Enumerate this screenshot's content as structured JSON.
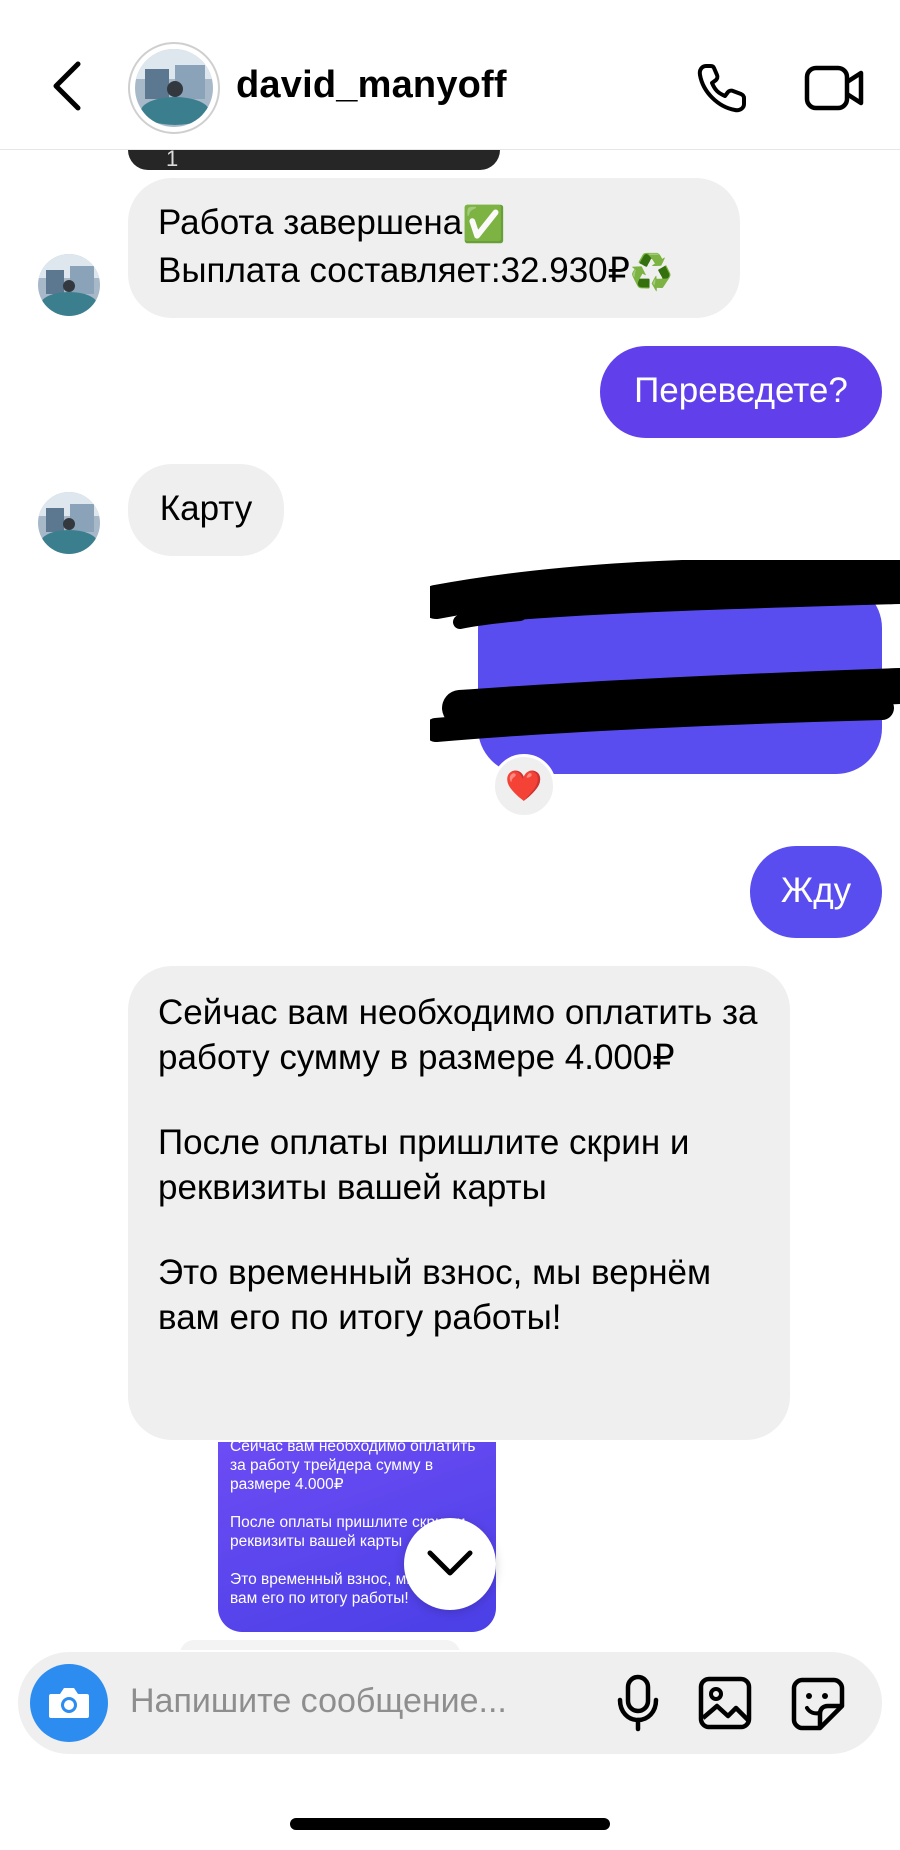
{
  "header": {
    "username": "david_manyoff",
    "icons": [
      "back-chevron-icon",
      "avatar",
      "phone-icon",
      "video-camera-icon"
    ]
  },
  "messages": {
    "stub_count": "1",
    "incoming_1": {
      "line1": "Работа завершена",
      "line1_emoji": "✅",
      "line2": "Выплата составляет:32.930₽",
      "line2_emoji": "♻️"
    },
    "outgoing_1": "Переведете?",
    "incoming_2": "Карту",
    "outgoing_2_redacted": "",
    "reaction": "❤️",
    "outgoing_3": "Жду",
    "incoming_3": {
      "p1": "Сейчас вам необходимо оплатить за работу сумму в размере 4.000₽",
      "p2": "После оплаты пришлите скрин и реквизиты вашей карты",
      "p3": "Это временный взнос, мы вернём вам его по итогу работы!"
    },
    "preview": {
      "p1": "Сейчас вам необходимо оплатить за работу трейдера сумму в размере 4.000₽",
      "p2": "После оплаты пришлите скрин и реквизиты вашей карты",
      "p3": "Это временный взнос, мы вернём вам его по итогу работы!"
    }
  },
  "composer": {
    "placeholder": "Напишите сообщение..."
  },
  "colors": {
    "outgoing_bubble": "#5a4df0",
    "incoming_bubble": "#efefef",
    "camera_button": "#2d8cf0"
  }
}
